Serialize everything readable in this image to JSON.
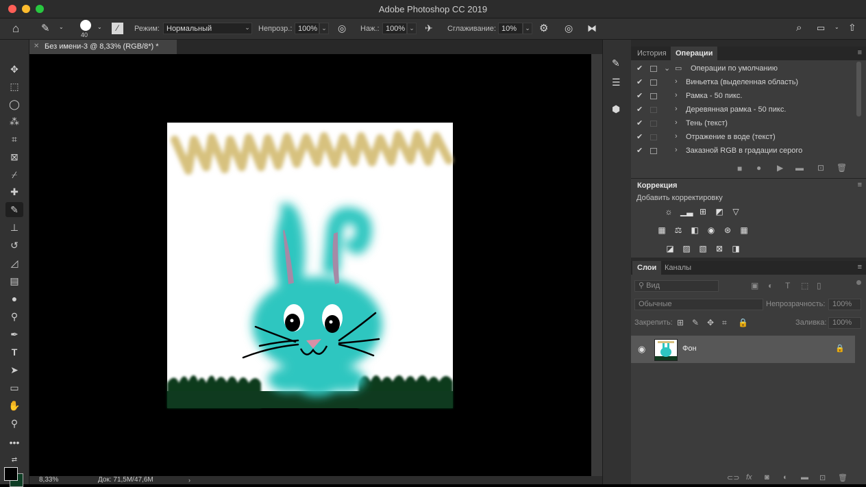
{
  "window": {
    "title": "Adobe Photoshop CC 2019",
    "traffic_lights": {
      "close": "#ff5f57",
      "minimize": "#febc2e",
      "maximize": "#28c840"
    }
  },
  "options_bar": {
    "brush_size": "40",
    "mode_label": "Режим:",
    "mode_value": "Нормальный",
    "opacity_label": "Непрозр.:",
    "opacity_value": "100%",
    "pressure_label": "Наж.:",
    "pressure_value": "100%",
    "smoothing_label": "Сглаживание:",
    "smoothing_value": "10%"
  },
  "document": {
    "tab_title": "Без имени-3 @ 8,33% (RGB/8*) *",
    "zoom": "8,33%",
    "doc_info": "Док: 71,5M/47,6M"
  },
  "actions_panel": {
    "tabs": [
      "История",
      "Операции"
    ],
    "active_tab": "Операции",
    "rows": [
      {
        "label": "Операции по умолчанию",
        "dialog": true,
        "folder": true
      },
      {
        "label": "Виньетка (выделенная область)",
        "dialog": true
      },
      {
        "label": "Рамка - 50 пикс.",
        "dialog": true
      },
      {
        "label": "Деревянная рамка - 50 пикс.",
        "dialog": false
      },
      {
        "label": "Тень (текст)",
        "dialog": false
      },
      {
        "label": "Отражение в воде (текст)",
        "dialog": false
      },
      {
        "label": "Заказной RGB в градации серого",
        "dialog": true
      }
    ]
  },
  "adjustments_panel": {
    "title": "Коррекция",
    "subtitle": "Добавить корректировку"
  },
  "layers_panel": {
    "tabs": [
      "Слои",
      "Каналы"
    ],
    "active_tab": "Слои",
    "search_placeholder": "Вид",
    "blend_mode": "Обычные",
    "opacity_label": "Непрозрачность:",
    "opacity_value": "100%",
    "lock_label": "Закрепить:",
    "fill_label": "Заливка:",
    "fill_value": "100%",
    "layers": [
      {
        "name": "Фон",
        "visible": true,
        "locked": true
      }
    ]
  },
  "colors": {
    "accent_fg": "#000000",
    "accent_bg": "#0d3d24",
    "bunny": "#2ec6c0",
    "grass": "#0f3a1f",
    "scribble": "#d7c17e"
  }
}
